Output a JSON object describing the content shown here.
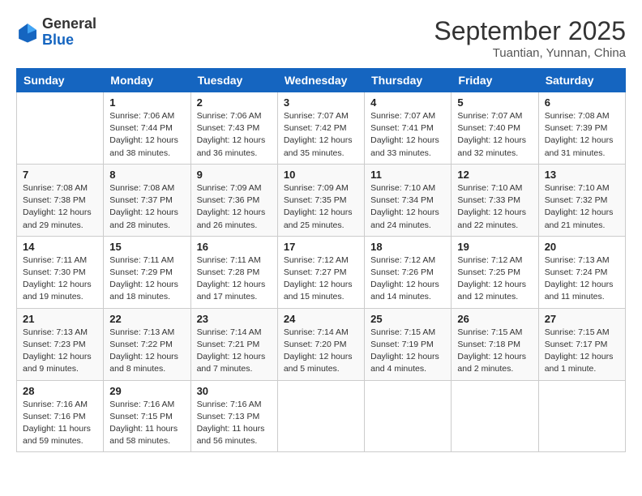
{
  "header": {
    "logo_general": "General",
    "logo_blue": "Blue",
    "month_title": "September 2025",
    "location": "Tuantian, Yunnan, China"
  },
  "days_of_week": [
    "Sunday",
    "Monday",
    "Tuesday",
    "Wednesday",
    "Thursday",
    "Friday",
    "Saturday"
  ],
  "weeks": [
    [
      {
        "num": "",
        "info": ""
      },
      {
        "num": "1",
        "info": "Sunrise: 7:06 AM\nSunset: 7:44 PM\nDaylight: 12 hours\nand 38 minutes."
      },
      {
        "num": "2",
        "info": "Sunrise: 7:06 AM\nSunset: 7:43 PM\nDaylight: 12 hours\nand 36 minutes."
      },
      {
        "num": "3",
        "info": "Sunrise: 7:07 AM\nSunset: 7:42 PM\nDaylight: 12 hours\nand 35 minutes."
      },
      {
        "num": "4",
        "info": "Sunrise: 7:07 AM\nSunset: 7:41 PM\nDaylight: 12 hours\nand 33 minutes."
      },
      {
        "num": "5",
        "info": "Sunrise: 7:07 AM\nSunset: 7:40 PM\nDaylight: 12 hours\nand 32 minutes."
      },
      {
        "num": "6",
        "info": "Sunrise: 7:08 AM\nSunset: 7:39 PM\nDaylight: 12 hours\nand 31 minutes."
      }
    ],
    [
      {
        "num": "7",
        "info": "Sunrise: 7:08 AM\nSunset: 7:38 PM\nDaylight: 12 hours\nand 29 minutes."
      },
      {
        "num": "8",
        "info": "Sunrise: 7:08 AM\nSunset: 7:37 PM\nDaylight: 12 hours\nand 28 minutes."
      },
      {
        "num": "9",
        "info": "Sunrise: 7:09 AM\nSunset: 7:36 PM\nDaylight: 12 hours\nand 26 minutes."
      },
      {
        "num": "10",
        "info": "Sunrise: 7:09 AM\nSunset: 7:35 PM\nDaylight: 12 hours\nand 25 minutes."
      },
      {
        "num": "11",
        "info": "Sunrise: 7:10 AM\nSunset: 7:34 PM\nDaylight: 12 hours\nand 24 minutes."
      },
      {
        "num": "12",
        "info": "Sunrise: 7:10 AM\nSunset: 7:33 PM\nDaylight: 12 hours\nand 22 minutes."
      },
      {
        "num": "13",
        "info": "Sunrise: 7:10 AM\nSunset: 7:32 PM\nDaylight: 12 hours\nand 21 minutes."
      }
    ],
    [
      {
        "num": "14",
        "info": "Sunrise: 7:11 AM\nSunset: 7:30 PM\nDaylight: 12 hours\nand 19 minutes."
      },
      {
        "num": "15",
        "info": "Sunrise: 7:11 AM\nSunset: 7:29 PM\nDaylight: 12 hours\nand 18 minutes."
      },
      {
        "num": "16",
        "info": "Sunrise: 7:11 AM\nSunset: 7:28 PM\nDaylight: 12 hours\nand 17 minutes."
      },
      {
        "num": "17",
        "info": "Sunrise: 7:12 AM\nSunset: 7:27 PM\nDaylight: 12 hours\nand 15 minutes."
      },
      {
        "num": "18",
        "info": "Sunrise: 7:12 AM\nSunset: 7:26 PM\nDaylight: 12 hours\nand 14 minutes."
      },
      {
        "num": "19",
        "info": "Sunrise: 7:12 AM\nSunset: 7:25 PM\nDaylight: 12 hours\nand 12 minutes."
      },
      {
        "num": "20",
        "info": "Sunrise: 7:13 AM\nSunset: 7:24 PM\nDaylight: 12 hours\nand 11 minutes."
      }
    ],
    [
      {
        "num": "21",
        "info": "Sunrise: 7:13 AM\nSunset: 7:23 PM\nDaylight: 12 hours\nand 9 minutes."
      },
      {
        "num": "22",
        "info": "Sunrise: 7:13 AM\nSunset: 7:22 PM\nDaylight: 12 hours\nand 8 minutes."
      },
      {
        "num": "23",
        "info": "Sunrise: 7:14 AM\nSunset: 7:21 PM\nDaylight: 12 hours\nand 7 minutes."
      },
      {
        "num": "24",
        "info": "Sunrise: 7:14 AM\nSunset: 7:20 PM\nDaylight: 12 hours\nand 5 minutes."
      },
      {
        "num": "25",
        "info": "Sunrise: 7:15 AM\nSunset: 7:19 PM\nDaylight: 12 hours\nand 4 minutes."
      },
      {
        "num": "26",
        "info": "Sunrise: 7:15 AM\nSunset: 7:18 PM\nDaylight: 12 hours\nand 2 minutes."
      },
      {
        "num": "27",
        "info": "Sunrise: 7:15 AM\nSunset: 7:17 PM\nDaylight: 12 hours\nand 1 minute."
      }
    ],
    [
      {
        "num": "28",
        "info": "Sunrise: 7:16 AM\nSunset: 7:16 PM\nDaylight: 11 hours\nand 59 minutes."
      },
      {
        "num": "29",
        "info": "Sunrise: 7:16 AM\nSunset: 7:15 PM\nDaylight: 11 hours\nand 58 minutes."
      },
      {
        "num": "30",
        "info": "Sunrise: 7:16 AM\nSunset: 7:13 PM\nDaylight: 11 hours\nand 56 minutes."
      },
      {
        "num": "",
        "info": ""
      },
      {
        "num": "",
        "info": ""
      },
      {
        "num": "",
        "info": ""
      },
      {
        "num": "",
        "info": ""
      }
    ]
  ]
}
